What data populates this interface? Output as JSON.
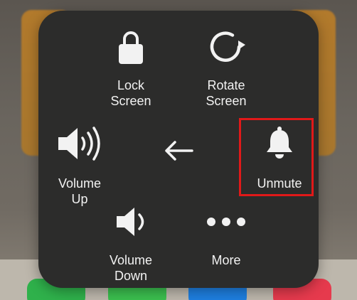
{
  "menu": {
    "lock_screen": {
      "line1": "Lock",
      "line2": "Screen",
      "icon": "lock-icon"
    },
    "rotate_screen": {
      "line1": "Rotate",
      "line2": "Screen",
      "icon": "rotate-icon"
    },
    "volume_up": {
      "line1": "Volume",
      "line2": "Up",
      "icon": "speaker-up-icon"
    },
    "back": {
      "icon": "arrow-left-icon"
    },
    "unmute": {
      "label": "Unmute",
      "icon": "bell-icon"
    },
    "volume_down": {
      "line1": "Volume",
      "line2": "Down",
      "icon": "speaker-down-icon"
    },
    "more": {
      "label": "More",
      "icon": "ellipsis-icon"
    }
  },
  "colors": {
    "menu_background": "#2c2c2b",
    "text": "#f2f2f2",
    "highlight_border": "#e01919"
  }
}
